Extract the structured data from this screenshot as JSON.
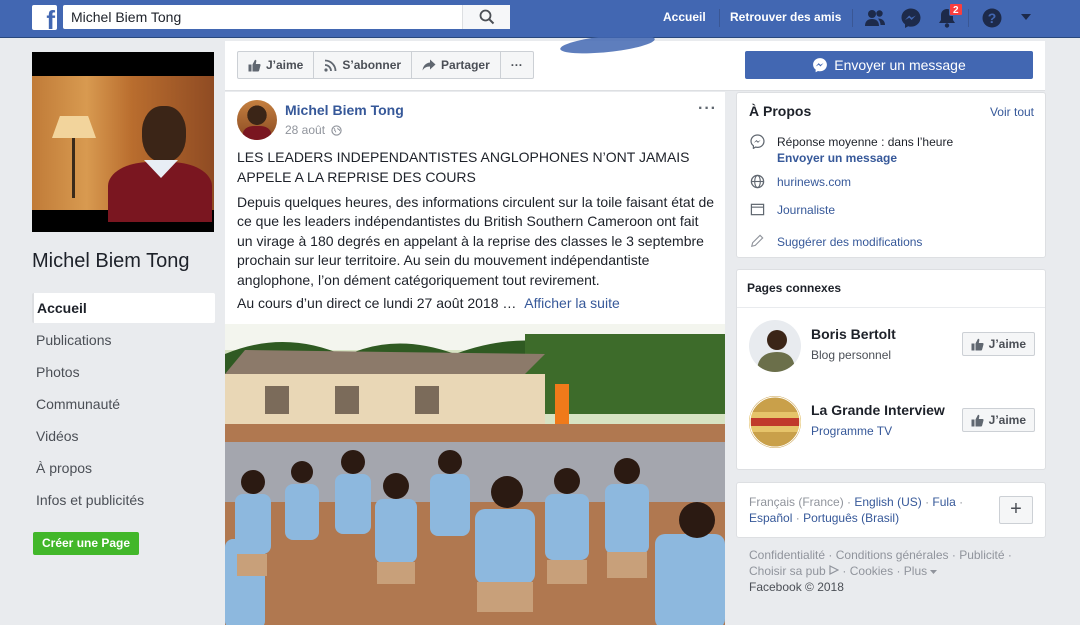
{
  "colors": {
    "brand": "#4267b2",
    "link": "#365899",
    "green": "#42b72a",
    "badge": "#fa3e3e"
  },
  "topbar": {
    "logo_icon": "facebook-f-icon",
    "search_value": "Michel Biem Tong",
    "search_icon": "search-icon",
    "nav": {
      "home": "Accueil",
      "find_friends": "Retrouver des amis"
    },
    "notifications_count": "2",
    "icons": [
      "friends-icon",
      "messenger-icon",
      "notifications-bell-icon",
      "help-icon",
      "chevron-down-icon"
    ]
  },
  "left": {
    "page_name": "Michel Biem Tong",
    "nav": [
      {
        "label": "Accueil",
        "active": true
      },
      {
        "label": "Publications"
      },
      {
        "label": "Photos"
      },
      {
        "label": "Communauté"
      },
      {
        "label": "Vidéos"
      },
      {
        "label": "À propos"
      },
      {
        "label": "Infos et publicités"
      }
    ],
    "create_page": "Créer une Page"
  },
  "actions": {
    "like": "J’aime",
    "follow": "S’abonner",
    "share": "Partager",
    "more": "···",
    "send_message": "Envoyer un message"
  },
  "post": {
    "author": "Michel Biem Tong",
    "date": "28 août",
    "more": "···",
    "headline": "LES LEADERS INDEPENDANTISTES ANGLOPHONES N’ONT JAMAIS APPELE A LA REPRISE DES COURS",
    "body": "Depuis quelques heures, des informations circulent sur la toile faisant état de ce que les leaders indépendantistes du British Southern Cameroon ont fait un virage à 180 degrés en appelant à la reprise des classes le 3 septembre prochain sur leur territoire. Au sein du mouvement indépendantiste anglophone, l’on dément catégoriquement tout revirement.",
    "continuation": "Au cours d’un direct ce lundi 27 août 2018 …",
    "see_more": "Afficher la suite"
  },
  "about": {
    "title": "À Propos",
    "see_all": "Voir tout",
    "response_time": "Réponse moyenne : dans l’heure",
    "send_message": "Envoyer un message",
    "website": "hurinews.com",
    "category": "Journaliste",
    "suggest": "Suggérer des modifications"
  },
  "related": {
    "title": "Pages connexes",
    "items": [
      {
        "name": "Boris Bertolt",
        "subtitle": "Blog personnel",
        "like": "J’aime"
      },
      {
        "name": "La Grande Interview",
        "subtitle": "Programme TV",
        "like": "J’aime"
      }
    ]
  },
  "languages": {
    "current": "Français (France)",
    "others": [
      "English (US)",
      "Fula",
      "Español",
      "Português (Brasil)"
    ],
    "sep": "·",
    "add": "+"
  },
  "footer": {
    "links": [
      "Confidentialité",
      "Conditions générales",
      "Publicité",
      "Choisir sa pub",
      "Cookies",
      "Plus"
    ],
    "sep": "·",
    "copyright": "Facebook © 2018"
  }
}
